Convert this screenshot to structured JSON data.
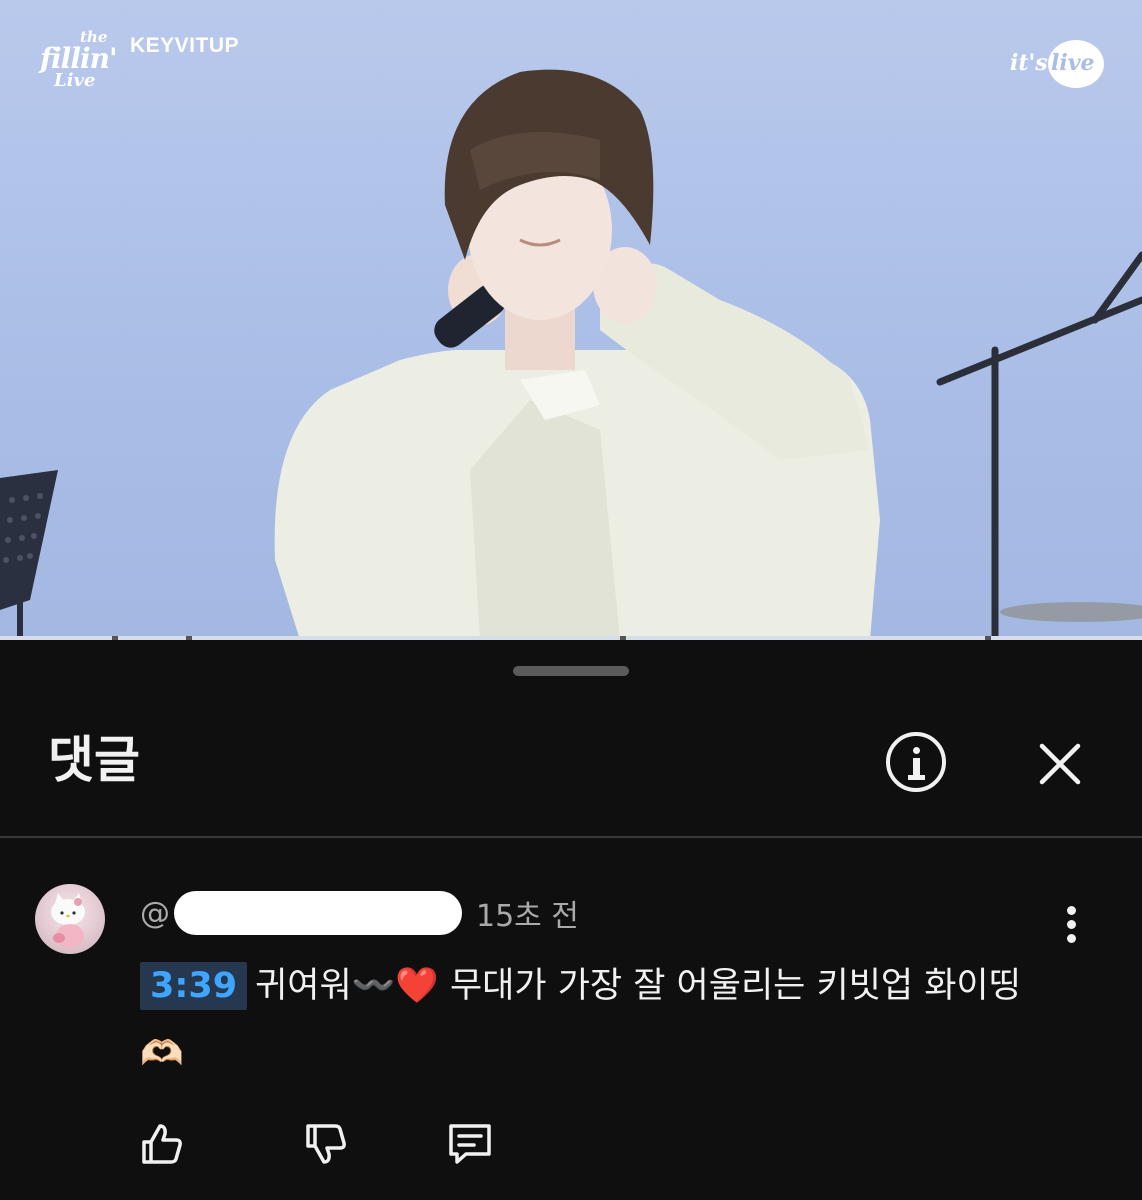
{
  "video": {
    "brand": {
      "the": "the",
      "fillin": "fillin'",
      "live": "Live"
    },
    "channel": "KEYVITUP",
    "watermark": {
      "its": "it's",
      "live": "live"
    }
  },
  "comments_panel": {
    "title": "댓글",
    "comment": {
      "author_prefix": "@",
      "time_ago": "15초 전",
      "timestamp_link": "3:39",
      "text_part1": "귀여워",
      "text_wave": "〰️",
      "text_heart": "❤️",
      "text_part2": " 무대가 가장 잘 어울리는 키빗업 화이띵",
      "text_hands": "🫶🏻"
    }
  },
  "colors": {
    "background": "#0f0f0f",
    "timestamp_link": "#3ea6ff",
    "timestamp_bg": "#263850",
    "secondary_text": "#aaaaaa",
    "primary_text": "#f1f1f1",
    "sky": "#a9bde6"
  },
  "icons": {
    "info": "info-circle-icon",
    "close": "close-icon",
    "more": "more-vert-icon",
    "like": "thumb-up-icon",
    "dislike": "thumb-down-icon",
    "reply": "reply-comment-icon"
  }
}
